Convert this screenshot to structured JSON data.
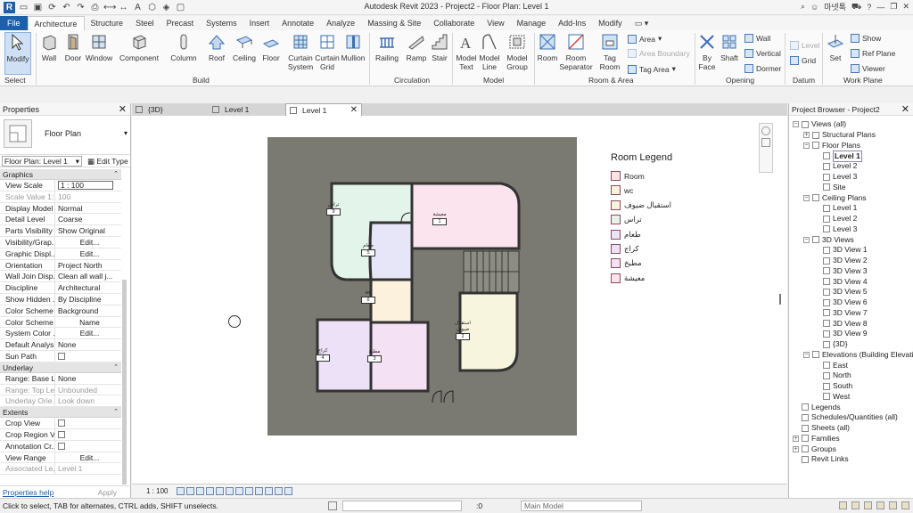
{
  "window": {
    "title": "Autodesk Revit 2023 - Project2 - Floor Plan: Level 1",
    "user": "마넷톡"
  },
  "ribbon_tabs": [
    "File",
    "Architecture",
    "Structure",
    "Steel",
    "Precast",
    "Systems",
    "Insert",
    "Annotate",
    "Analyze",
    "Massing & Site",
    "Collaborate",
    "View",
    "Manage",
    "Add-Ins",
    "Modify"
  ],
  "ribbon": {
    "modify": "Modify",
    "select": "Select",
    "build": {
      "label": "Build",
      "items": [
        "Wall",
        "Door",
        "Window",
        "Component",
        "Column",
        "Roof",
        "Ceiling",
        "Floor",
        "Curtain\nSystem",
        "Curtain\nGrid",
        "Mullion"
      ]
    },
    "circulation": {
      "label": "Circulation",
      "items": [
        "Railing",
        "Ramp",
        "Stair"
      ]
    },
    "model": {
      "label": "Model",
      "items": [
        "Model\nText",
        "Model\nLine",
        "Model\nGroup"
      ]
    },
    "room_area": {
      "label": "Room & Area",
      "items": [
        "Room",
        "Room\nSeparator",
        "Tag\nRoom"
      ],
      "small": [
        "Area",
        "Area Boundary",
        "Tag Area"
      ]
    },
    "opening": {
      "label": "Opening",
      "items": [
        "By\nFace",
        "Shaft"
      ],
      "small": [
        "Wall",
        "Vertical",
        "Dormer"
      ]
    },
    "datum": {
      "label": "Datum",
      "small": [
        "Level",
        "Grid"
      ]
    },
    "work_plane": {
      "label": "Work Plane",
      "set": "Set",
      "small": [
        "Show",
        "Ref Plane",
        "Viewer"
      ]
    }
  },
  "properties": {
    "title": "Properties",
    "type_name": "Floor Plan",
    "selector": "Floor Plan: Level 1",
    "edit_type": "Edit Type",
    "groups": [
      {
        "name": "Graphics",
        "rows": [
          {
            "k": "View Scale",
            "v": "1 : 100",
            "kind": "input"
          },
          {
            "k": "Scale Value    1:",
            "v": "100",
            "kind": "disabled"
          },
          {
            "k": "Display Model",
            "v": "Normal"
          },
          {
            "k": "Detail Level",
            "v": "Coarse"
          },
          {
            "k": "Parts Visibility",
            "v": "Show Original"
          },
          {
            "k": "Visibility/Grap...",
            "v": "Edit...",
            "kind": "button"
          },
          {
            "k": "Graphic Displ...",
            "v": "Edit...",
            "kind": "button"
          },
          {
            "k": "Orientation",
            "v": "Project North"
          },
          {
            "k": "Wall Join Disp...",
            "v": "Clean all wall j..."
          },
          {
            "k": "Discipline",
            "v": "Architectural"
          },
          {
            "k": "Show Hidden ...",
            "v": "By Discipline"
          },
          {
            "k": "Color Scheme ...",
            "v": "Background"
          },
          {
            "k": "Color Scheme",
            "v": "Name",
            "kind": "button"
          },
          {
            "k": "System Color ...",
            "v": "Edit...",
            "kind": "button"
          },
          {
            "k": "Default Analys...",
            "v": "None"
          },
          {
            "k": "Sun Path",
            "v": "",
            "kind": "checkbox"
          }
        ]
      },
      {
        "name": "Underlay",
        "rows": [
          {
            "k": "Range: Base L...",
            "v": "None"
          },
          {
            "k": "Range: Top Le...",
            "v": "Unbounded",
            "kind": "disabled"
          },
          {
            "k": "Underlay Orie...",
            "v": "Look down",
            "kind": "disabled"
          }
        ]
      },
      {
        "name": "Extents",
        "rows": [
          {
            "k": "Crop View",
            "v": "",
            "kind": "checkbox"
          },
          {
            "k": "Crop Region V...",
            "v": "",
            "kind": "checkbox"
          },
          {
            "k": "Annotation Cr...",
            "v": "",
            "kind": "checkbox"
          },
          {
            "k": "View Range",
            "v": "Edit...",
            "kind": "button"
          },
          {
            "k": "Associated Le...",
            "v": "Level 1",
            "kind": "disabled"
          }
        ]
      }
    ],
    "help": "Properties help",
    "apply": "Apply"
  },
  "view_tabs": [
    {
      "label": "{3D}",
      "active": false
    },
    {
      "label": "Level 1",
      "active": false
    },
    {
      "label": "Level 1",
      "active": true
    }
  ],
  "plan": {
    "rooms": [
      {
        "name": "تراس",
        "number": "9",
        "color": "#e3f5ea"
      },
      {
        "name": "معيشة",
        "number": "1",
        "color": "#fbe4ee"
      },
      {
        "name": "طعام",
        "number": "5",
        "color": "#e6e6f8"
      },
      {
        "name": "wc",
        "number": "6",
        "color": "#fbf1dc"
      },
      {
        "name": "كراج",
        "number": "4",
        "color": "#ece1f6"
      },
      {
        "name": "مطبخ",
        "number": "3",
        "color": "#f4e1f4"
      },
      {
        "name": "استقبال ضيوف",
        "number": "2",
        "color": "#f7f5dd"
      }
    ]
  },
  "legend": {
    "title": "Room Legend",
    "items": [
      {
        "label": "Room",
        "color": "#fde4e4"
      },
      {
        "label": "wc",
        "color": "#fbf1dc"
      },
      {
        "label": "استقبال ضيوف",
        "color": "#f7f5dd"
      },
      {
        "label": "تراس",
        "color": "#e3f5ea"
      },
      {
        "label": "طعام",
        "color": "#e6e6f8"
      },
      {
        "label": "كراج",
        "color": "#ece1f6"
      },
      {
        "label": "مطبخ",
        "color": "#f4e1f4"
      },
      {
        "label": "معيشة",
        "color": "#fbe4ee"
      }
    ]
  },
  "view_status": {
    "scale": "1 : 100"
  },
  "browser": {
    "title": "Project Browser - Project2",
    "tree": [
      {
        "label": "Views (all)",
        "level": 0,
        "toggle": "-"
      },
      {
        "label": "Structural Plans",
        "level": 1,
        "toggle": "+"
      },
      {
        "label": "Floor Plans",
        "level": 1,
        "toggle": "-"
      },
      {
        "label": "Level 1",
        "level": 2,
        "selected": true
      },
      {
        "label": "Level 2",
        "level": 2
      },
      {
        "label": "Level 3",
        "level": 2
      },
      {
        "label": "Site",
        "level": 2
      },
      {
        "label": "Ceiling Plans",
        "level": 1,
        "toggle": "-"
      },
      {
        "label": "Level 1",
        "level": 2
      },
      {
        "label": "Level 2",
        "level": 2
      },
      {
        "label": "Level 3",
        "level": 2
      },
      {
        "label": "3D Views",
        "level": 1,
        "toggle": "-"
      },
      {
        "label": "3D View 1",
        "level": 2
      },
      {
        "label": "3D View 2",
        "level": 2
      },
      {
        "label": "3D View 3",
        "level": 2
      },
      {
        "label": "3D View 4",
        "level": 2
      },
      {
        "label": "3D View 5",
        "level": 2
      },
      {
        "label": "3D View 6",
        "level": 2
      },
      {
        "label": "3D View 7",
        "level": 2
      },
      {
        "label": "3D View 8",
        "level": 2
      },
      {
        "label": "3D View 9",
        "level": 2
      },
      {
        "label": "{3D}",
        "level": 2
      },
      {
        "label": "Elevations (Building Elevation)",
        "level": 1,
        "toggle": "-"
      },
      {
        "label": "East",
        "level": 2
      },
      {
        "label": "North",
        "level": 2
      },
      {
        "label": "South",
        "level": 2
      },
      {
        "label": "West",
        "level": 2
      },
      {
        "label": "Legends",
        "level": 0
      },
      {
        "label": "Schedules/Quantities (all)",
        "level": 0
      },
      {
        "label": "Sheets (all)",
        "level": 0
      },
      {
        "label": "Families",
        "level": 0,
        "toggle": "+"
      },
      {
        "label": "Groups",
        "level": 0,
        "toggle": "+"
      },
      {
        "label": "Revit Links",
        "level": 0
      }
    ]
  },
  "status": {
    "message": "Click to select, TAB for alternates, CTRL adds, SHIFT unselects.",
    "zero": ":0",
    "model": "Main Model"
  },
  "colors": {
    "file_tab": "#1d5fa8",
    "accent": "#3d6fb0"
  }
}
